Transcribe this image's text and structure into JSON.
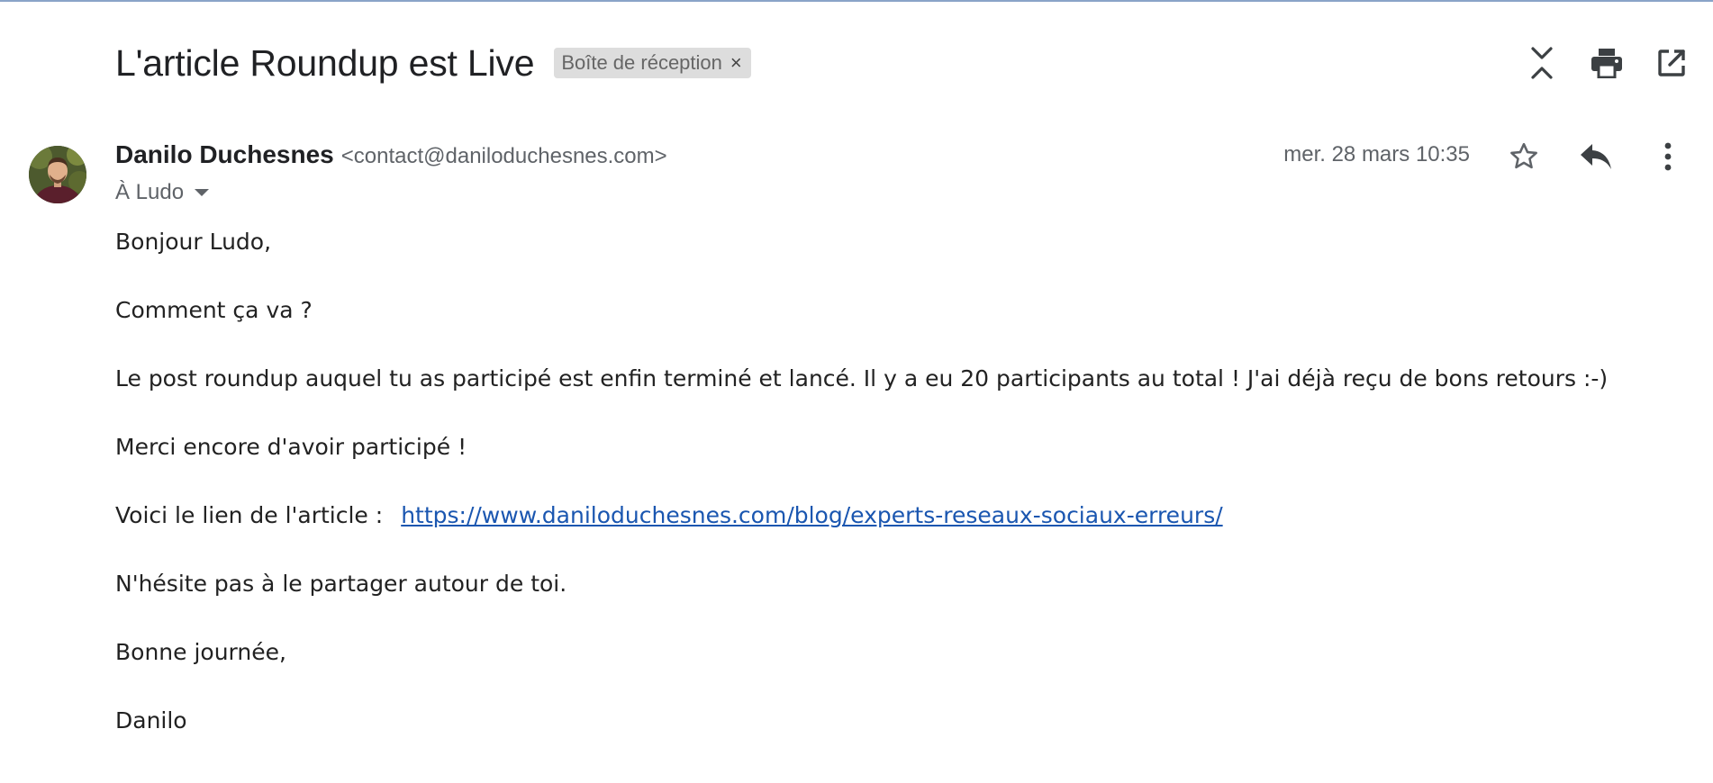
{
  "email": {
    "subject": "L'article Roundup est Live",
    "label_chip": {
      "text": "Boîte de réception",
      "close_glyph": "×"
    },
    "top_actions": [
      {
        "name": "collapse-all-icon",
        "label": "Tout réduire"
      },
      {
        "name": "print-icon",
        "label": "Imprimer"
      },
      {
        "name": "open-in-new-window-icon",
        "label": "Nouvelle fenêtre"
      }
    ],
    "sender": {
      "name": "Danilo Duchesnes",
      "email": "<contact@daniloduchesnes.com>",
      "avatar": "avatar-photo"
    },
    "recipient": "À Ludo",
    "date": "mer. 28 mars 10:35",
    "message_actions": [
      {
        "name": "star-icon"
      },
      {
        "name": "reply-icon"
      },
      {
        "name": "more-options-icon"
      }
    ],
    "body": {
      "greeting": "Bonjour Ludo,",
      "line1": "Comment ça va ?",
      "line2": "Le post roundup auquel tu as participé est enfin terminé et lancé. Il y a eu 20 participants au total ! J'ai déjà reçu de bons retours :-)",
      "line3": "Merci encore d'avoir participé !",
      "link_prefix": "Voici le lien de l'article :",
      "link_url": "https://www.daniloduchesnes.com/blog/experts-reseaux-sociaux-erreurs/",
      "line4": "N'hésite pas à le partager autour de toi.",
      "closing": "Bonne journée,",
      "signature": "Danilo"
    }
  },
  "colors": {
    "link": "#1a56b0",
    "chip_bg": "#dddddd",
    "secondary_text": "#5f6368",
    "icon": "#5f6368",
    "top_rule": "#8aa4c8"
  }
}
